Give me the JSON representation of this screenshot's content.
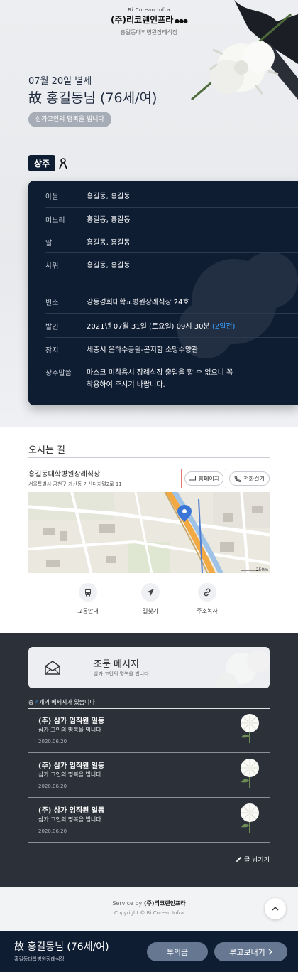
{
  "brand": {
    "tagline": "Ri Corean Infra",
    "logo": "(주)리코렌인프라",
    "hall": "홍길동대학병원장례식장"
  },
  "obituary": {
    "date": "07월 20일 별세",
    "name": "故 홍길동님 (76세/여)",
    "condolence": "삼가고인의 명복을 빕니다"
  },
  "mourners": {
    "tag": "상주",
    "rows": [
      {
        "key": "아들",
        "value": "홍길동, 홍길동"
      },
      {
        "key": "며느리",
        "value": "홍길동, 홍길동"
      },
      {
        "key": "딸",
        "value": "홍길동, 홍길동"
      },
      {
        "key": "사위",
        "value": "홍길동, 홍길동"
      }
    ]
  },
  "details": {
    "room": {
      "key": "빈소",
      "value": "강동경희대학교병원장례식장 24호"
    },
    "departure": {
      "key": "발인",
      "value": "2021년 07월 31일 (토요일) 09시 30분",
      "dday": "(2일전)"
    },
    "burial": {
      "key": "장지",
      "value": "세종시 은하수공원-곤지함 소망수양관"
    },
    "notice": {
      "key": "상주말씀",
      "line1": "마스크 미착용시 장례식장 출입을 할 수 없으니 꼭",
      "line2": "착용하여 주시기 바랍니다."
    }
  },
  "directions": {
    "title": "오시는 길",
    "venue": "홍길동대학병원장례식장",
    "address": "서울특별시 금천구 가산동 가산디지털2로 11",
    "homepage": "홈페이지",
    "call": "전화걸기",
    "map_scale": "250m",
    "actions": [
      {
        "label": "교통안내",
        "icon": "bus-icon"
      },
      {
        "label": "길찾기",
        "icon": "navigation-icon"
      },
      {
        "label": "주소복사",
        "icon": "link-icon"
      }
    ]
  },
  "messages": {
    "title": "조문 메시지",
    "subtitle": "삼가 고인의 명복을 빕니다",
    "count_prefix": "총 ",
    "count": "4",
    "count_suffix": "개의 메세지가 있습니다",
    "items": [
      {
        "author": "(주) 삼가 임직원 일동",
        "text": "삼가 고인의 명복을 빕니다",
        "date": "2020.06.20"
      },
      {
        "author": "(주) 삼가 임직원 일동",
        "text": "삼가 고인의 명복을 빕니다",
        "date": "2020.06.20"
      },
      {
        "author": "(주) 삼가 임직원 일동",
        "text": "삼가 고인의 명복을 빕니다",
        "date": "2020.06.20"
      }
    ],
    "write": "글 남기기"
  },
  "footer": {
    "service_by": "Service by",
    "service_brand": "(주)리코렌인프라",
    "copyright": "Copyright © Ri Corean Infra"
  },
  "bottom_bar": {
    "name": "故 홍길동님 (76세/여)",
    "hall": "홍길동대학병원장례식장",
    "donation": "부의금",
    "send": "부고보내기"
  },
  "colors": {
    "navy": "#0f1d33",
    "accent_blue": "#3aa0ff",
    "dark_section": "#2c3139",
    "pill": "#667791"
  }
}
